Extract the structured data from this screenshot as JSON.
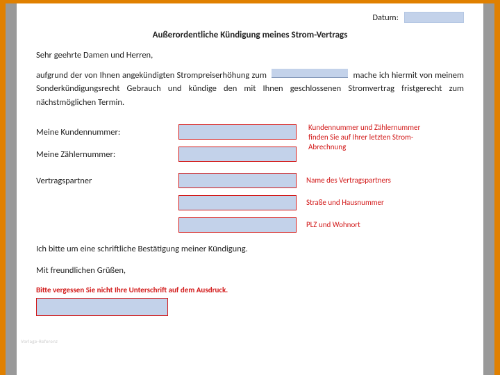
{
  "header": {
    "date_label": "Datum:"
  },
  "title": "Außerordentliche Kündigung meines Strom-Vertrags",
  "salutation": "Sehr geehrte Damen und Herren,",
  "body": {
    "part1": "aufgrund der von Ihnen angekündigten Strompreiserhöhung zum",
    "part2": "mache ich hiermit von meinem Sonderkündigungsrecht Gebrauch und kündige den mit Ihnen geschlossenen Stromvertrag fristgerecht zum nächstmöglichen Termin."
  },
  "labels": {
    "kundennummer": "Meine Kundennummer:",
    "zaehlernummer": "Meine Zählernummer:",
    "vertragspartner": "Vertragspartner"
  },
  "hints": {
    "kundennummer_zaehler": "Kundennummer und Zählernummer finden Sie auf Ihrer letzten Strom-Abrechnung",
    "name": "Name des Vertragspartners",
    "strasse": "Straße und Hausnummer",
    "plz": "PLZ und Wohnort",
    "signature": "Bitte vergessen Sie nicht Ihre Unterschrift auf dem Ausdruck."
  },
  "confirm": "Ich bitte um eine schriftliche Bestätigung meiner Kündigung.",
  "closing": "Mit freundlichen Grüßen,",
  "watermark": "Vorlage-Referenz"
}
